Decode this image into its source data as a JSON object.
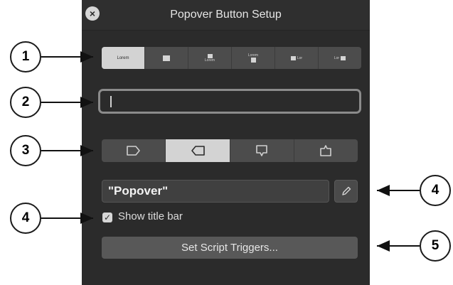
{
  "window": {
    "title": "Popover Button Setup",
    "close_icon": "close-icon"
  },
  "style_segments": [
    {
      "label": "Lorem",
      "selected": true
    },
    {
      "label": "",
      "selected": false
    },
    {
      "label": "Lorem",
      "selected": false
    },
    {
      "label": "Lorem",
      "selected": false
    },
    {
      "label": "Lor",
      "selected": false
    },
    {
      "label": "Lor",
      "selected": false
    }
  ],
  "label_field": {
    "value": ""
  },
  "direction_segments": [
    {
      "icon": "popover-arrow-right-icon",
      "selected": false
    },
    {
      "icon": "popover-arrow-left-icon",
      "selected": true
    },
    {
      "icon": "popover-arrow-down-icon",
      "selected": false
    },
    {
      "icon": "popover-arrow-up-icon",
      "selected": false
    }
  ],
  "popover_name": {
    "value": "\"Popover\"",
    "edit_icon": "pencil-icon"
  },
  "show_title_bar": {
    "label": "Show title bar",
    "checked": true
  },
  "script_triggers_button": {
    "label": "Set Script Triggers..."
  },
  "callouts": {
    "c1": "1",
    "c2": "2",
    "c3": "3",
    "c4a": "4",
    "c4b": "4",
    "c5": "5"
  },
  "colors": {
    "panel": "#2b2b2b",
    "selected": "#d3d3d3",
    "button": "#585858"
  }
}
